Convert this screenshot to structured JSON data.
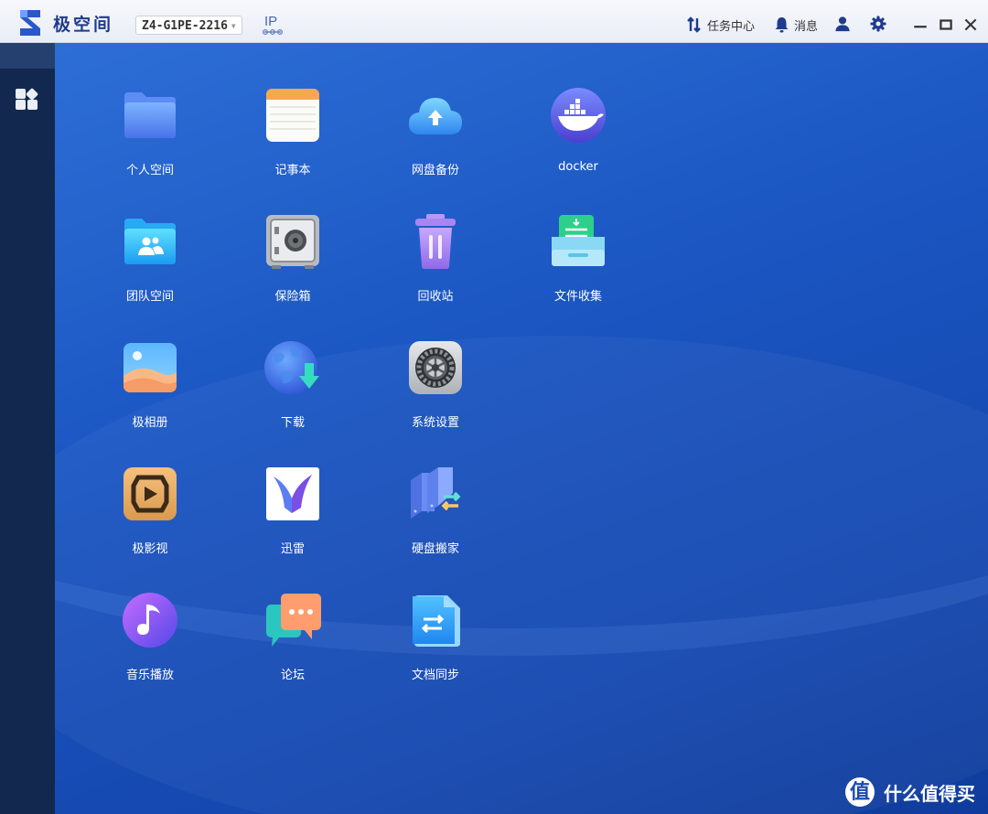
{
  "titlebar": {
    "brand": "极空间",
    "device": "Z4-G1PE-2216",
    "ip_label": "IP",
    "tasks_label": "任务中心",
    "messages_label": "消息"
  },
  "apps": [
    {
      "label": "个人空间",
      "icon": "folder-icon"
    },
    {
      "label": "记事本",
      "icon": "notepad-icon"
    },
    {
      "label": "网盘备份",
      "icon": "cloud-upload-icon"
    },
    {
      "label": "docker",
      "icon": "docker-whale-icon"
    },
    {
      "label": "团队空间",
      "icon": "team-folder-icon"
    },
    {
      "label": "保险箱",
      "icon": "safe-icon"
    },
    {
      "label": "回收站",
      "icon": "trash-icon"
    },
    {
      "label": "文件收集",
      "icon": "file-collect-icon"
    },
    {
      "label": "极相册",
      "icon": "photo-album-icon"
    },
    {
      "label": "下载",
      "icon": "download-globe-icon"
    },
    {
      "label": "系统设置",
      "icon": "settings-gear-icon"
    },
    {
      "label": "极影视",
      "icon": "video-icon"
    },
    {
      "label": "迅雷",
      "icon": "thunder-bird-icon"
    },
    {
      "label": "硬盘搬家",
      "icon": "disk-migrate-icon"
    },
    {
      "label": "音乐播放",
      "icon": "music-note-icon"
    },
    {
      "label": "论坛",
      "icon": "forum-chat-icon"
    },
    {
      "label": "文档同步",
      "icon": "doc-sync-icon"
    }
  ],
  "watermark": {
    "glyph": "值",
    "text": "什么值得买"
  },
  "colors": {
    "desktop_bg": "#1b56c2",
    "sidebar_bg": "#13284e",
    "brand": "#1f3b8c"
  }
}
